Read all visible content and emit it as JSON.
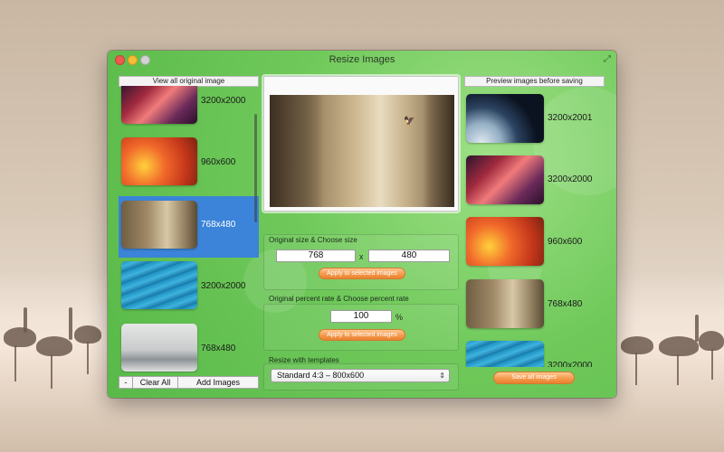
{
  "window": {
    "title": "Resize Images"
  },
  "left_panel": {
    "header": "View all original image",
    "items": [
      {
        "size": "3200x2000",
        "image": "canyon"
      },
      {
        "size": "960x600",
        "image": "leaves"
      },
      {
        "size": "768x480",
        "image": "fog-cliffs",
        "selected": true
      },
      {
        "size": "3200x2000",
        "image": "water"
      },
      {
        "size": "768x480",
        "image": "mist"
      }
    ],
    "remove_label": "-",
    "clear_label": "Clear All",
    "add_label": "Add Images"
  },
  "size_group": {
    "title": "Original size & Choose size",
    "width_value": "768",
    "separator": "x",
    "height_value": "480",
    "apply_label": "Apply to selected images"
  },
  "percent_group": {
    "title": "Original percent rate & Choose percent rate",
    "value": "100",
    "unit": "%",
    "apply_label": "Apply to selected images"
  },
  "template_group": {
    "title": "Resize with templates",
    "selected": "Standard 4:3 – 800x600"
  },
  "right_panel": {
    "header": "Preview images before saving",
    "items": [
      {
        "size": "3200x2001",
        "image": "earth"
      },
      {
        "size": "3200x2000",
        "image": "canyon"
      },
      {
        "size": "960x600",
        "image": "leaves"
      },
      {
        "size": "768x480",
        "image": "fog-cliffs"
      },
      {
        "size": "3200x2000",
        "image": "water"
      }
    ],
    "save_label": "Save all images"
  },
  "colors": {
    "accent_selection": "#3b84d9",
    "window_green": "#6fc95a",
    "button_orange": "#f49a4e"
  }
}
